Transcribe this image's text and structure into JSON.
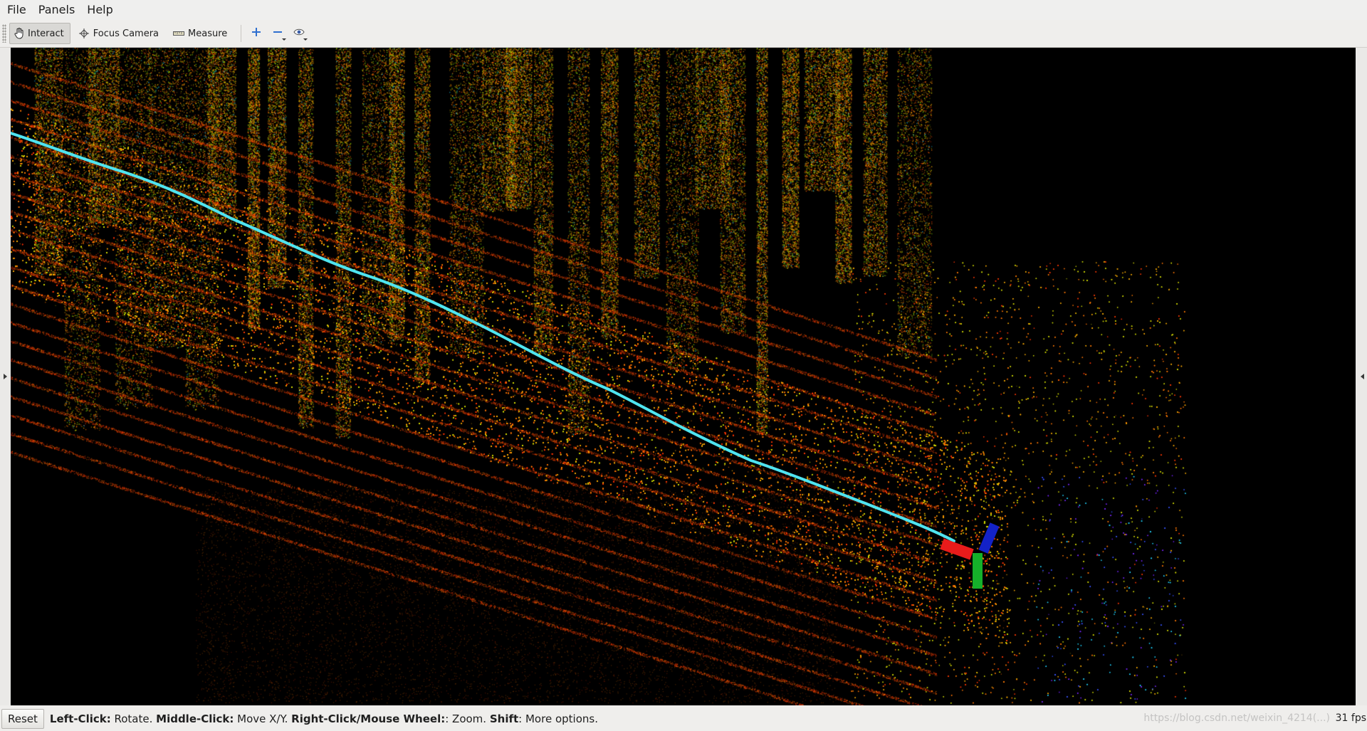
{
  "menubar": {
    "file": "File",
    "panels": "Panels",
    "help": "Help"
  },
  "toolbar": {
    "interact": "Interact",
    "focus_camera": "Focus Camera",
    "measure": "Measure",
    "icons": [
      "hand-icon",
      "crosshair-icon",
      "ruler-icon",
      "plus-icon",
      "minus-icon",
      "eye-icon"
    ]
  },
  "viewport": {
    "background": "#000000",
    "trajectory_color": "#4fe4f0",
    "axis_x_color": "#e81b1b",
    "axis_y_color": "#15b02a",
    "axis_z_color": "#1322c8",
    "pointcloud_palette": [
      "#ff3b00",
      "#ff7a00",
      "#ffb000",
      "#d9e000",
      "#7ee000",
      "#25d4ff",
      "#3b55ff",
      "#7a2bff"
    ]
  },
  "statusbar": {
    "reset": "Reset",
    "hints": [
      {
        "key": "Left-Click:",
        "desc": " Rotate. "
      },
      {
        "key": "Middle-Click:",
        "desc": " Move X/Y. "
      },
      {
        "key": "Right-Click/Mouse Wheel:",
        "desc": ": Zoom. "
      },
      {
        "key": "Shift",
        "desc": ": More options."
      }
    ],
    "watermark": "https://blog.csdn.net/weixin_4214(...)",
    "fps": "31 fps"
  }
}
